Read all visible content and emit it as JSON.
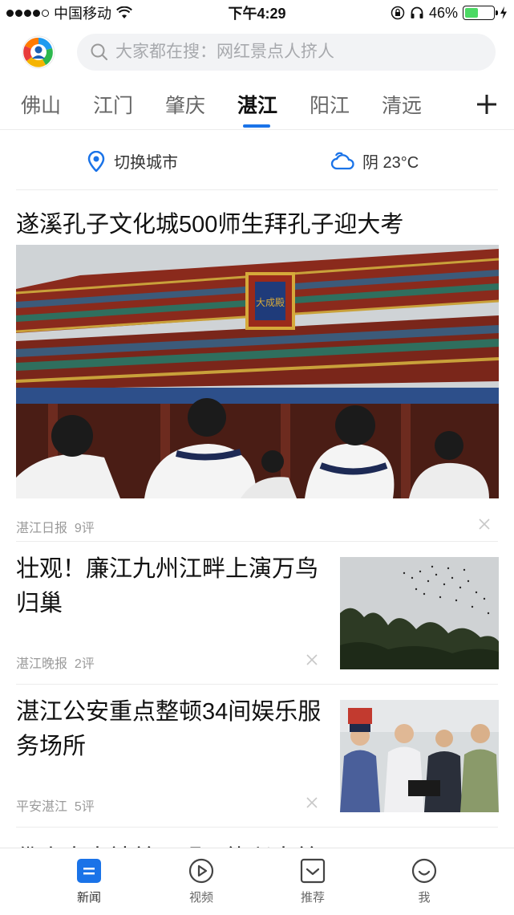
{
  "status_bar": {
    "carrier": "中国移动",
    "time": "下午4:29",
    "battery": "46%",
    "battery_level": 0.46
  },
  "search": {
    "placeholder": "大家都在搜：网红景点人挤人"
  },
  "city_tabs": [
    {
      "label": "佛山"
    },
    {
      "label": "江门"
    },
    {
      "label": "肇庆"
    },
    {
      "label": "湛江",
      "active": true
    },
    {
      "label": "阳江"
    },
    {
      "label": "清远"
    }
  ],
  "info_bar": {
    "switch_city": "切换城市",
    "weather": "阴 23°C"
  },
  "feed": {
    "top_article": {
      "title": "遂溪孔子文化城500师生拜孔子迎大考",
      "plaque_text": "大成殿",
      "source": "湛江日报",
      "comments": "9评"
    },
    "articles": [
      {
        "title_line1": "壮观！廉江九州江畔上演万鸟",
        "title_line2": "归巢",
        "source": "湛江晚报",
        "comments": "2评"
      },
      {
        "title_line1": "湛江公安重点整顿34间娱乐服",
        "title_line2": "务场所",
        "source": "平安湛江",
        "comments": "5评"
      }
    ],
    "partial_title": "佛山大古社美一明显能兴大美"
  },
  "bottom_nav": [
    {
      "label": "新闻",
      "icon": "news-icon",
      "active": true
    },
    {
      "label": "视频",
      "icon": "video-icon"
    },
    {
      "label": "推荐",
      "icon": "recommend-icon"
    },
    {
      "label": "我",
      "icon": "profile-icon"
    }
  ],
  "colors": {
    "accent": "#1a73e8",
    "battery_green": "#4cd964"
  }
}
